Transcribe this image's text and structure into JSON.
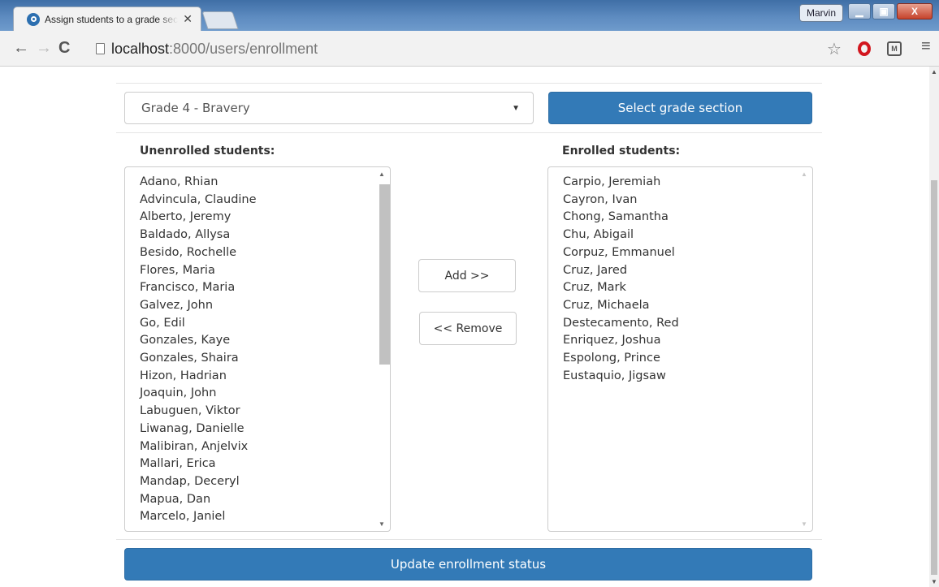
{
  "browser": {
    "tab_title": "Assign students to a grade section",
    "tab_close": "✕",
    "user_badge": "Marvin",
    "window_buttons": {
      "minimize": "▁",
      "maximize": "▣",
      "close": "X"
    },
    "nav": {
      "back": "←",
      "forward": "→",
      "reload": "C"
    },
    "url_host": "localhost",
    "url_path": ":8000/users/enrollment",
    "icons": [
      "star-icon",
      "opera-icon",
      "extension-icon",
      "menu-icon"
    ]
  },
  "page": {
    "grade_select": {
      "value": "Grade 4 - Bravery",
      "caret": "▼"
    },
    "select_section_button": "Select grade section",
    "unenrolled_label": "Unenrolled students:",
    "enrolled_label": "Enrolled students:",
    "unenrolled_students": [
      "Adano, Rhian",
      "Advincula, Claudine",
      "Alberto, Jeremy",
      "Baldado, Allysa",
      "Besido, Rochelle",
      "Flores, Maria",
      "Francisco, Maria",
      "Galvez, John",
      "Go, Edil",
      "Gonzales, Kaye",
      "Gonzales, Shaira",
      "Hizon, Hadrian",
      "Joaquin, John",
      "Labuguen, Viktor",
      "Liwanag, Danielle",
      "Malibiran, Anjelvix",
      "Mallari, Erica",
      "Mandap, Deceryl",
      "Mapua, Dan",
      "Marcelo, Janiel"
    ],
    "enrolled_students": [
      "Carpio, Jeremiah",
      "Cayron, Ivan",
      "Chong, Samantha",
      "Chu, Abigail",
      "Corpuz, Emmanuel",
      "Cruz, Jared",
      "Cruz, Mark",
      "Cruz, Michaela",
      "Destecamento, Red",
      "Enriquez, Joshua",
      "Espolong, Prince",
      "Eustaquio, Jigsaw"
    ],
    "add_button": "Add >>",
    "remove_button": "<< Remove",
    "update_button": "Update enrollment status"
  },
  "colors": {
    "primary": "#337ab7",
    "border": "#cccccc",
    "text": "#333333"
  }
}
